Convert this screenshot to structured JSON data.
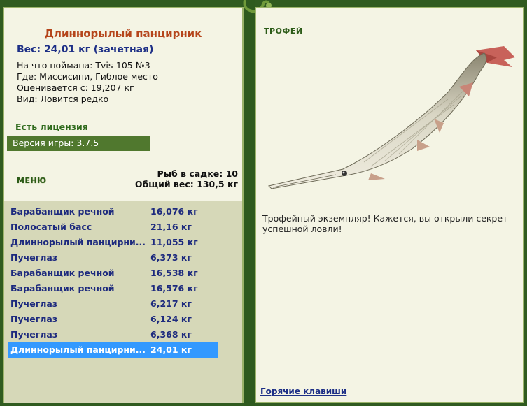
{
  "fish": {
    "title": "Длиннорылый панцирник",
    "weight_line": "Вес: 24,01 кг (зачетная)",
    "caught_on": "На что поймана: Tvis-105 №3",
    "where": "Где: Миссисипи, Гиблое место",
    "value": "Оценивается с: 19,207 кг",
    "kind": "Вид: Ловится редко"
  },
  "license": "Есть лицензия",
  "version": "Версия игры: 3.7.5",
  "menu_label": "МЕНЮ",
  "stats": {
    "count": "Рыб в садке: 10",
    "total": "Общий вес: 130,5 кг"
  },
  "catch_list": [
    {
      "name": "Барабанщик речной",
      "weight": "16,076 кг"
    },
    {
      "name": "Полосатый басс",
      "weight": "21,16 кг"
    },
    {
      "name": "Длиннорылый панцирни...",
      "weight": "11,055 кг"
    },
    {
      "name": "Пучеглаз",
      "weight": "6,373 кг"
    },
    {
      "name": "Барабанщик речной",
      "weight": "16,538 кг"
    },
    {
      "name": "Барабанщик речной",
      "weight": "16,576 кг"
    },
    {
      "name": "Пучеглаз",
      "weight": "6,217 кг"
    },
    {
      "name": "Пучеглаз",
      "weight": "6,124 кг"
    },
    {
      "name": "Пучеглаз",
      "weight": "6,368 кг"
    },
    {
      "name": "Длиннорылый панцирни...",
      "weight": "24,01 кг",
      "selected": true
    }
  ],
  "trophy_label": "ТРОФЕЙ",
  "trophy_text": "Трофейный экземпляр! Кажется, вы открыли секрет успешной ловли!",
  "hotkeys": "Горячие клавиши",
  "colors": {
    "frame": "#305b20",
    "panel": "#f4f4e4",
    "list_bg": "#d6d8b8",
    "selection": "#3399ff",
    "title": "#b5451b",
    "link": "#1d2f86"
  }
}
